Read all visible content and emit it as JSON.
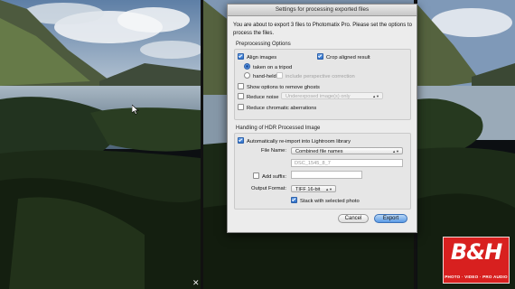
{
  "dialog": {
    "title": "Settings for processing exported files",
    "intro": "You are about to export 3 files to Photomatix Pro.  Please set the options to process the files.",
    "preprocessing": {
      "heading": "Preprocessing Options",
      "align_images": "Align images",
      "crop_aligned": "Crop aligned result",
      "taken_on_tripod": "taken on a tripod",
      "hand_held": "hand-held",
      "include_perspective": "include perspective correction",
      "remove_ghosts": "Show options to remove ghosts",
      "reduce_noise": "Reduce noise",
      "noise_option": "Underexposed image(s) only",
      "reduce_chromatic": "Reduce chromatic aberrations"
    },
    "hdr": {
      "heading": "Handling of HDR Processed Image",
      "auto_reimport": "Automatically re-import into Lightroom library",
      "file_name_label": "File Name:",
      "file_name_value": "Combined file names",
      "file_name_preview": "DSC_1545_8_7",
      "add_suffix": "Add suffix:",
      "output_format_label": "Output Format:",
      "output_format_value": "TIFF 16-bit",
      "stack": "Stack with selected photo"
    },
    "buttons": {
      "cancel": "Cancel",
      "export": "Export"
    }
  },
  "logo": {
    "mark": "B&H",
    "tagline": "PHOTO · VIDEO · PRO AUDIO"
  },
  "misc": {
    "close_glyph": "✕"
  },
  "colors": {
    "accent": "#3c7fd8",
    "brand_red": "#d8201f"
  }
}
